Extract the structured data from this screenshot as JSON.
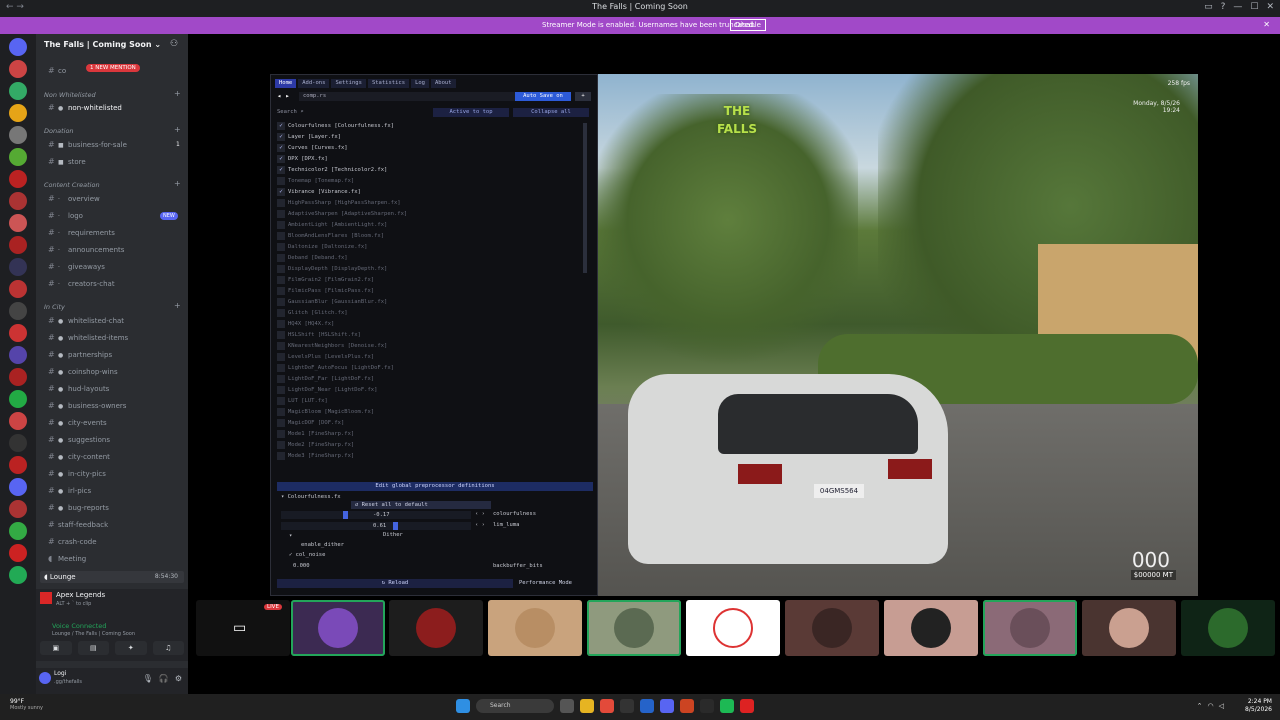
{
  "window": {
    "title": "The Falls | Coming Soon"
  },
  "banner": {
    "text": "Streamer Mode is enabled. Usernames have been truncated.",
    "disable_label": "Disable"
  },
  "server": {
    "name": "The Falls | Coming Soon",
    "new_mention_label": "1 NEW MENTION"
  },
  "channels": {
    "top_partial": "co",
    "categories": [
      {
        "label": "Non Whitelisted",
        "items": [
          {
            "name": "non-whitelisted",
            "active": true
          }
        ]
      },
      {
        "label": "Donation",
        "items": [
          {
            "name": "business-for-sale",
            "count": "1"
          },
          {
            "name": "store"
          }
        ]
      },
      {
        "label": "Content Creation",
        "items": [
          {
            "name": "overview"
          },
          {
            "name": "logo",
            "tag": "NEW"
          },
          {
            "name": "requirements"
          },
          {
            "name": "announcements"
          },
          {
            "name": "giveaways"
          },
          {
            "name": "creators-chat"
          }
        ]
      },
      {
        "label": "In City",
        "items": [
          {
            "name": "whitelisted-chat"
          },
          {
            "name": "whitelisted-items"
          },
          {
            "name": "partnerships"
          },
          {
            "name": "coinshop-wins"
          },
          {
            "name": "hud-layouts"
          },
          {
            "name": "business-owners"
          },
          {
            "name": "city-events"
          },
          {
            "name": "suggestions"
          },
          {
            "name": "city-content"
          },
          {
            "name": "in-city-pics"
          },
          {
            "name": "irl-pics"
          },
          {
            "name": "bug-reports"
          },
          {
            "name": "staff-feedback"
          },
          {
            "name": "crash-code"
          },
          {
            "name": "Meeting"
          }
        ]
      }
    ],
    "lounge": {
      "name": "Lounge",
      "time": "8:54:30"
    }
  },
  "activity": {
    "game": "Apex Legends",
    "sub": "ALT + ` to clip"
  },
  "voice": {
    "status": "Voice Connected",
    "location": "Lounge / The Falls | Coming Soon"
  },
  "user": {
    "name": "Logi",
    "tag": ".gg/thefalls"
  },
  "reshade": {
    "tabs": [
      "Home",
      "Add-ons",
      "Settings",
      "Statistics",
      "Log",
      "About"
    ],
    "preset": "comp.rs",
    "auto_save": "Auto Save on",
    "search_label": "Search",
    "active_to_top": "Active to top",
    "collapse_all": "Collapse all",
    "effects": [
      {
        "label": "Colourfulness [Colourfulness.fx]",
        "on": true
      },
      {
        "label": "Layer [Layer.fx]",
        "on": true
      },
      {
        "label": "Curves [Curves.fx]",
        "on": true
      },
      {
        "label": "DPX [DPX.fx]",
        "on": true
      },
      {
        "label": "Technicolor2 [Technicolor2.fx]",
        "on": true
      },
      {
        "label": "Tonemap [Tonemap.fx]",
        "on": false
      },
      {
        "label": "Vibrance [Vibrance.fx]",
        "on": true
      },
      {
        "label": "HighPassSharp [HighPassSharpen.fx]",
        "on": false
      },
      {
        "label": "AdaptiveSharpen [AdaptiveSharpen.fx]",
        "on": false
      },
      {
        "label": "AmbientLight [AmbientLight.fx]",
        "on": false
      },
      {
        "label": "BloomAndLensFlares [Bloom.fx]",
        "on": false
      },
      {
        "label": "Daltonize [Daltonize.fx]",
        "on": false
      },
      {
        "label": "Deband [Deband.fx]",
        "on": false
      },
      {
        "label": "DisplayDepth [DisplayDepth.fx]",
        "on": false
      },
      {
        "label": "FilmGrain2 [FilmGrain2.fx]",
        "on": false
      },
      {
        "label": "FilmicPass [FilmicPass.fx]",
        "on": false
      },
      {
        "label": "GaussianBlur [GaussianBlur.fx]",
        "on": false
      },
      {
        "label": "Glitch [Glitch.fx]",
        "on": false
      },
      {
        "label": "HQ4X [HQ4X.fx]",
        "on": false
      },
      {
        "label": "HSLShift [HSLShift.fx]",
        "on": false
      },
      {
        "label": "KNearestNeighbors [Denoise.fx]",
        "on": false
      },
      {
        "label": "LevelsPlus [LevelsPlus.fx]",
        "on": false
      },
      {
        "label": "LightDoF_AutoFocus [LightDoF.fx]",
        "on": false
      },
      {
        "label": "LightDoF_Far [LightDoF.fx]",
        "on": false
      },
      {
        "label": "LightDoF_Near [LightDoF.fx]",
        "on": false
      },
      {
        "label": "LUT [LUT.fx]",
        "on": false
      },
      {
        "label": "MagicBloom [MagicBloom.fx]",
        "on": false
      },
      {
        "label": "MagicDOF [DOF.fx]",
        "on": false
      },
      {
        "label": "Mode1 [FineSharp.fx]",
        "on": false
      },
      {
        "label": "Mode2 [FineSharp.fx]",
        "on": false
      },
      {
        "label": "Mode3 [FineSharp.fx]",
        "on": false
      }
    ],
    "defs_header": "Edit global preprocessor definitions",
    "defs_file": "Colourfulness.fx",
    "reset_label": "Reset all to default",
    "params": [
      {
        "value": "-0.17",
        "name": "colourfulness"
      },
      {
        "value": "0.61",
        "name": "lim_luma"
      }
    ],
    "dither_label": "Dither",
    "enable_dither": "enable_dither",
    "col_noise": "col_noise",
    "zero_value": "0.000",
    "backbuffer": "backbuffer_bits",
    "reload_label": "Reload",
    "perf_mode": "Performance Mode"
  },
  "game": {
    "logo_text": "THE FALLS",
    "fps": "258 fps",
    "hud_date": "Monday, 8/5/26",
    "hud_time": "19:24",
    "plate": "04GMS564",
    "speed": "000",
    "cash": "$00000 MT"
  },
  "strip": {
    "live_label": "LIVE"
  },
  "taskbar": {
    "temp": "99°F",
    "weather": "Mostly sunny",
    "search": "Search",
    "time": "2:24 PM",
    "date": "8/5/2026"
  },
  "colors": {
    "accent": "#5865f2",
    "banner": "#a149c8",
    "speaking": "#23a55a",
    "danger": "#da373c"
  }
}
